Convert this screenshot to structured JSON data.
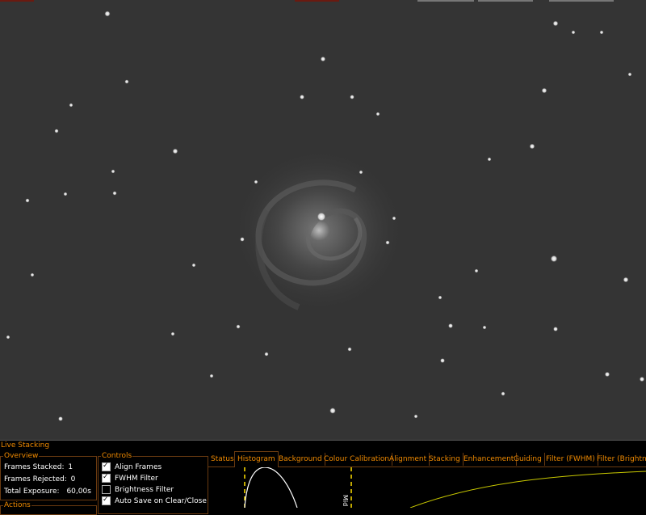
{
  "app": {
    "accent_color": "#f08a00",
    "panel_title": "Live Stacking"
  },
  "image": {
    "description_kind": "deep-sky astrophoto viewer"
  },
  "overview": {
    "label": "Overview",
    "frames_stacked_label": "Frames Stacked:",
    "frames_stacked_value": "1",
    "frames_rejected_label": "Frames Rejected:",
    "frames_rejected_value": "0",
    "total_exposure_label": "Total Exposure:",
    "total_exposure_value": "60,00s"
  },
  "actions": {
    "label": "Actions"
  },
  "controls": {
    "label": "Controls",
    "align_frames": {
      "label": "Align Frames",
      "checked": true
    },
    "fwhm_filter": {
      "label": "FWHM Filter",
      "checked": true
    },
    "brightness_filter": {
      "label": "Brightness Filter",
      "checked": false
    },
    "auto_save": {
      "label": "Auto Save on Clear/Close",
      "checked": true
    }
  },
  "tabs": [
    {
      "label": "Status"
    },
    {
      "label": "Histogram",
      "active": true
    },
    {
      "label": "Background"
    },
    {
      "label": "Colour Calibration"
    },
    {
      "label": "Alignment"
    },
    {
      "label": "Stacking"
    },
    {
      "label": "Enhancement"
    },
    {
      "label": "Guiding"
    },
    {
      "label": "Filter (FWHM)"
    },
    {
      "label": "Filter (Brightnes"
    }
  ],
  "histogram": {
    "marker_label": "Mid"
  }
}
